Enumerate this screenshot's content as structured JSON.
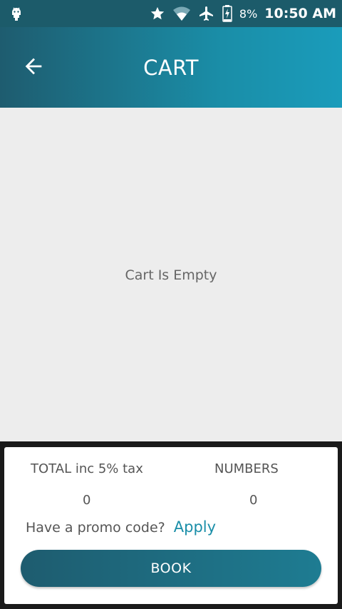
{
  "status_bar": {
    "battery_percent": "8%",
    "time": "10:50 AM",
    "icons": [
      "android-debug-icon",
      "star-icon",
      "wifi-icon",
      "airplane-icon",
      "battery-charging-icon"
    ]
  },
  "app_bar": {
    "title": "CART",
    "back_icon": "arrow-left-icon"
  },
  "content": {
    "empty_message": "Cart Is Empty"
  },
  "summary": {
    "total_label": "TOTAL inc 5% tax",
    "total_value": "0",
    "numbers_label": "NUMBERS",
    "numbers_value": "0",
    "promo_text": "Have a promo code?",
    "promo_action": "Apply",
    "book_label": "BOOK"
  },
  "colors": {
    "primary_dark": "#1e5c6f",
    "primary_light": "#1a9cbb",
    "accent": "#1a8ea8",
    "background": "#ededed"
  }
}
